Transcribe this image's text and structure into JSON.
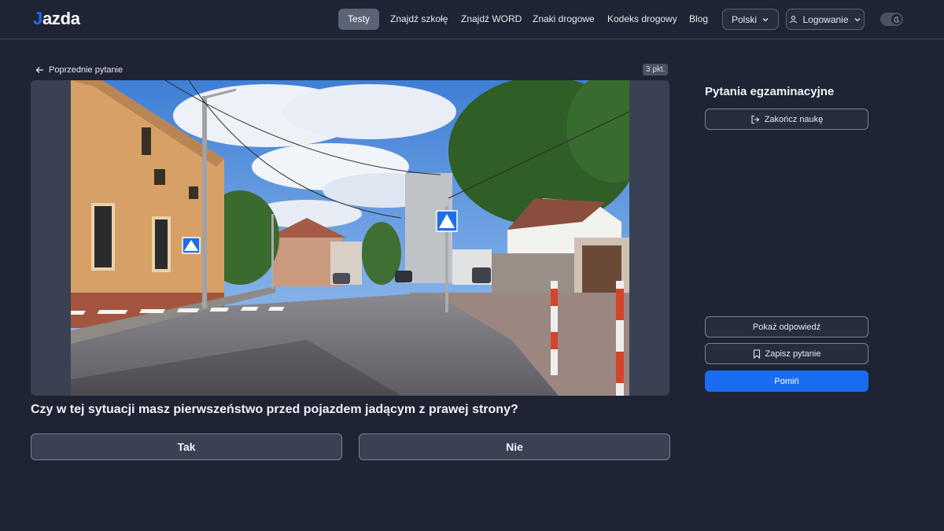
{
  "brand": {
    "logo_text": "azda",
    "logo_hook": "J",
    "accent_color": "#1a6cf0"
  },
  "nav": {
    "items": [
      {
        "label": "Testy",
        "active": true
      },
      {
        "label": "Znajdź szkołę"
      },
      {
        "label": "Znajdź WORD"
      },
      {
        "label": "Znaki drogowe"
      },
      {
        "label": "Kodeks drogowy"
      },
      {
        "label": "Blog"
      }
    ],
    "language": "Polski",
    "login": "Logowanie",
    "theme_icon": "moon-icon"
  },
  "main": {
    "back_label": "Poprzednie pytanie",
    "points": "3 pkt.",
    "question": "Czy w tej sytuacji masz pierwszeństwo przed pojazdem jadącym z prawej strony?",
    "answers": [
      "Tak",
      "Nie"
    ]
  },
  "sidebar": {
    "title": "Pytania egzaminacyjne",
    "end_label": "Zakończ naukę",
    "show_answer_label": "Pokaż odpowiedź",
    "save_label": "Zapisz pytanie",
    "skip_label": "Pomiń"
  }
}
